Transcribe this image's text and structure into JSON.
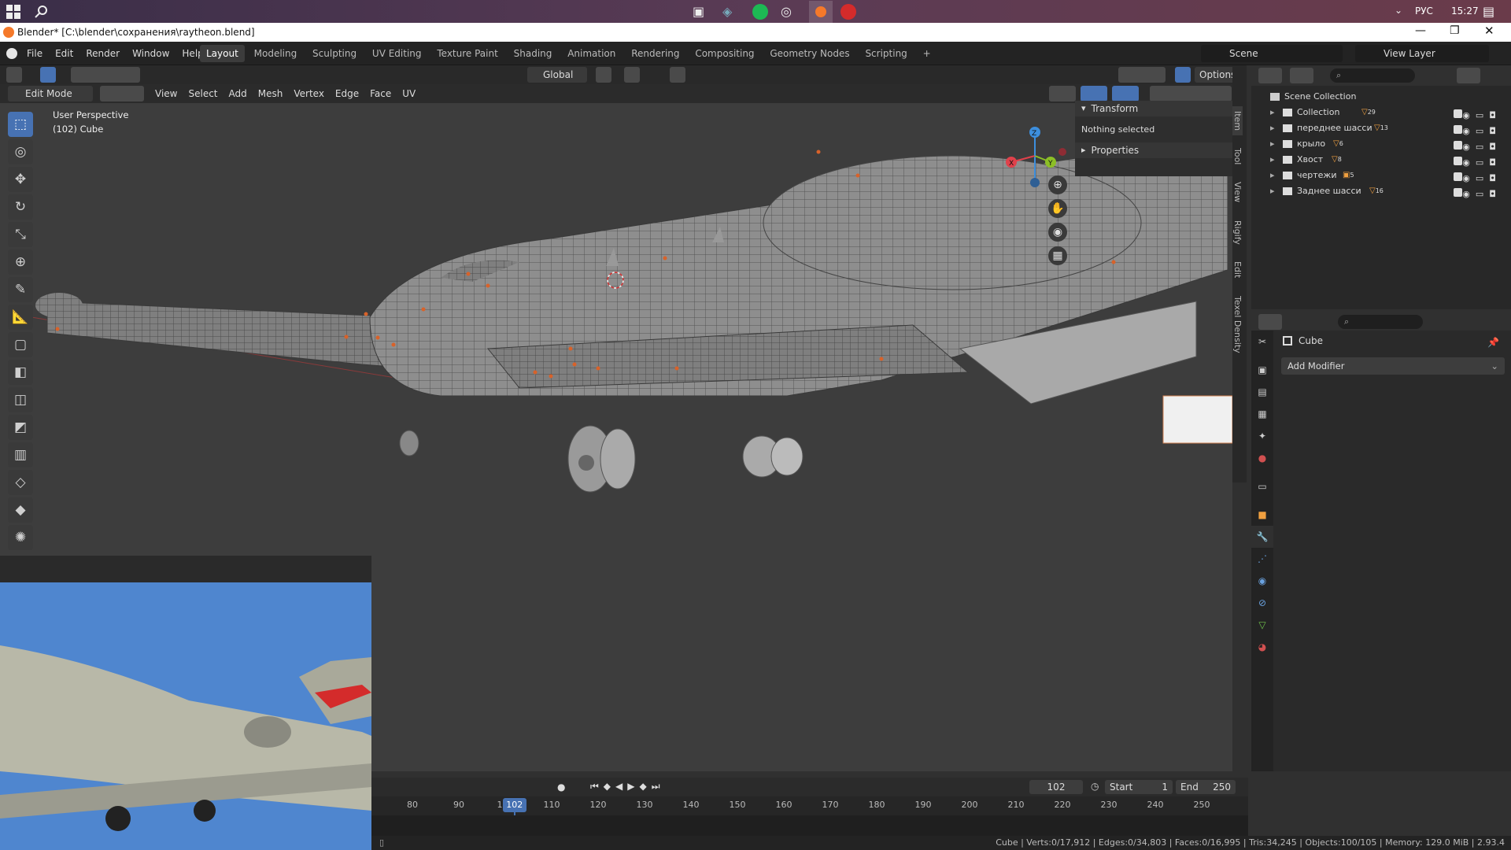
{
  "taskbar": {
    "lang": "РУС",
    "time": "15:27"
  },
  "window": {
    "title": "Blender* [C:\\blender\\сохранения\\raytheon.blend]"
  },
  "menubar": {
    "menus": [
      "File",
      "Edit",
      "Render",
      "Window",
      "Help"
    ],
    "workspaces": [
      "Layout",
      "Modeling",
      "Sculpting",
      "UV Editing",
      "Texture Paint",
      "Shading",
      "Animation",
      "Rendering",
      "Compositing",
      "Geometry Nodes",
      "Scripting"
    ],
    "active_workspace": "Layout",
    "scene": "Scene",
    "view_layer": "View Layer"
  },
  "viewport": {
    "header": {
      "transform_orientation": "Global",
      "options": "Options"
    },
    "header2": {
      "mode": "Edit Mode",
      "menus": [
        "View",
        "Select",
        "Add",
        "Mesh",
        "Vertex",
        "Edge",
        "Face",
        "UV"
      ]
    },
    "info_line1": "User Perspective",
    "info_line2": "(102) Cube",
    "gizmo": {
      "x": "X",
      "y": "Y",
      "z": "Z"
    },
    "npanel": {
      "transform": "Transform",
      "nothing_selected": "Nothing selected",
      "properties": "Properties"
    },
    "tabs": [
      "Item",
      "Tool",
      "View",
      "Rigify",
      "Edit",
      "Texel Density"
    ]
  },
  "outliner": {
    "root": "Scene Collection",
    "items": [
      {
        "name": "Collection",
        "count": "29"
      },
      {
        "name": "переднее шасси",
        "count": "13"
      },
      {
        "name": "крыло",
        "count": "6"
      },
      {
        "name": "Хвост",
        "count": "8"
      },
      {
        "name": "чертежи",
        "count": "5"
      },
      {
        "name": "Заднее шасси",
        "count": "16"
      }
    ]
  },
  "properties": {
    "object": "Cube",
    "add_modifier": "Add Modifier"
  },
  "timeline": {
    "current_frame": "102",
    "start_label": "Start",
    "start": "1",
    "end_label": "End",
    "end": "250",
    "ticks": [
      "80",
      "90",
      "100",
      "110",
      "120",
      "130",
      "140",
      "150",
      "160",
      "170",
      "180",
      "190",
      "200",
      "210",
      "220",
      "230",
      "240",
      "250"
    ]
  },
  "status": {
    "text": "Cube | Verts:0/17,912 | Edges:0/34,803 | Faces:0/16,995 | Tris:34,245 | Objects:100/105 | Memory: 129.0 MiB | 2.93.4"
  },
  "colors": {
    "accent": "#4772b3",
    "axis_x": "#e0414b",
    "axis_y": "#8cbf26",
    "axis_z": "#3d8fde"
  }
}
